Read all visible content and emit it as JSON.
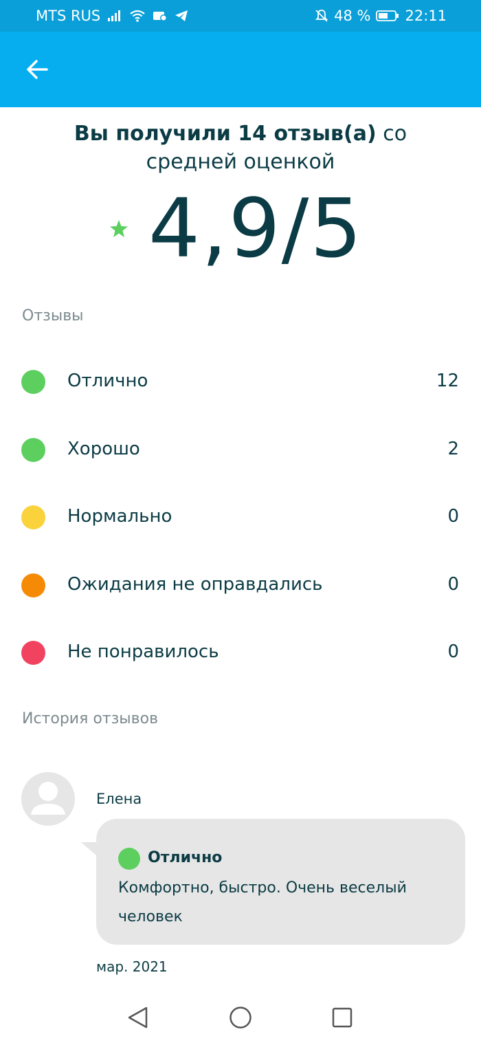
{
  "status_bar": {
    "carrier": "MTS RUS",
    "battery": "48 %",
    "time": "22:11"
  },
  "summary": {
    "prefix": "Вы получили 14 отзыв(а)",
    "suffix": " со средней оценкой",
    "rating": "4,9/5"
  },
  "reviews": {
    "title": "Отзывы",
    "items": [
      {
        "label": "Отлично",
        "count": "12",
        "color": "#5ccf5f"
      },
      {
        "label": "Хорошо",
        "count": "2",
        "color": "#5ccf5f"
      },
      {
        "label": "Нормально",
        "count": "0",
        "color": "#f9d23c"
      },
      {
        "label": "Ожидания не оправдались",
        "count": "0",
        "color": "#f58a07"
      },
      {
        "label": "Не понравилось",
        "count": "0",
        "color": "#f1435f"
      }
    ]
  },
  "history": {
    "title": "История отзывов",
    "entries": [
      {
        "author": "Елена",
        "grade": "Отлично",
        "text": "Комфортно, быстро. Очень веселый человек",
        "date": "мар. 2021"
      }
    ]
  },
  "colors": {
    "status_bar": "#0a9fd8",
    "app_bar": "#06aef0",
    "text_primary": "#0b3b44",
    "text_muted": "#7c8a8e",
    "star": "#5ccf5f"
  }
}
